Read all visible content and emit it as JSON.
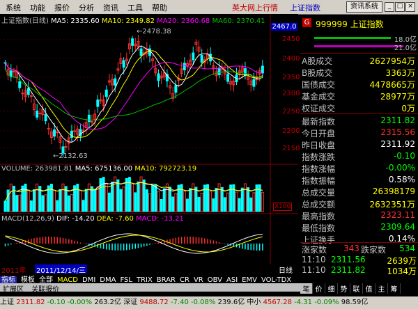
{
  "menu": [
    "系统",
    "功能",
    "报价",
    "分析",
    "资讯",
    "工具",
    "帮助"
  ],
  "menu_title": "英大网上行情",
  "menu_index": "上证指数",
  "menu_button": "资讯系统",
  "colors": {
    "up": "#ff3030",
    "down": "#00ffff",
    "ma5": "#ffffff",
    "ma10": "#ffff00",
    "ma20": "#ff00ff",
    "ma60": "#00c000",
    "label": "#c00000"
  },
  "chart_head": {
    "name": "上证指数(日线)",
    "ma5": "MA5: 2335.60",
    "ma10": "MA10: 2349.82",
    "ma20": "MA20: 2360.68",
    "ma60": "MA60: 2370.41"
  },
  "price_box": "2467.0",
  "high_label": "2478.38",
  "low_label": "2132.63",
  "price_axis": [
    "2450",
    "2400",
    "2350",
    "2300",
    "2250",
    "2200",
    "2150"
  ],
  "volume_head": {
    "vol": "VOLUME: 263981.81",
    "ma5": "MA5: 675136.00",
    "ma10": "MA10: 792723.19"
  },
  "vol_unit": "X100",
  "macd_head": {
    "label": "MACD(12,26,9)",
    "dif": "DIF: -14.20",
    "dea": "DEA: -7.60",
    "macd": "MACD: -13.21"
  },
  "bottom_axis": {
    "year": "2011年",
    "date": "2011/12/14/三",
    "day_label": "日线"
  },
  "tabs": [
    "指标",
    "模板",
    "全部",
    "MACD",
    "DMI",
    "DMA",
    "FSL",
    "TRIX",
    "BRAR",
    "CR",
    "VR",
    "OBV",
    "ASI",
    "EMV",
    "VOL-TDX"
  ],
  "ext_tabs": [
    "扩展区",
    "关联报价"
  ],
  "right_tabs": [
    "笔",
    "价",
    "细",
    "势",
    "联",
    "值",
    "主",
    "筹"
  ],
  "right": {
    "g_label": "G",
    "code": "999999 上证指数",
    "pct1": "18.0亿",
    "pct2": "21.0亿",
    "rows1": [
      {
        "label": "A股成交",
        "value": "2627954万",
        "color": "#ffff00"
      },
      {
        "label": "B股成交",
        "value": "3363万",
        "color": "#ffff00"
      },
      {
        "label": "国债成交",
        "value": "4478665万",
        "color": "#ffff00"
      },
      {
        "label": "基金成交",
        "value": "28977万",
        "color": "#ffff00"
      },
      {
        "label": "权证成交",
        "value": "0万",
        "color": "#ffff00"
      }
    ],
    "rows2": [
      {
        "label": "最新指数",
        "value": "2311.82",
        "color": "#00ff00"
      },
      {
        "label": "今日开盘",
        "value": "2315.56",
        "color": "#ff3030"
      },
      {
        "label": "昨日收盘",
        "value": "2311.92",
        "color": "#ffffff"
      },
      {
        "label": "指数涨跌",
        "value": "-0.10",
        "color": "#00ff00"
      },
      {
        "label": "指数涨幅",
        "value": "-0.00%",
        "color": "#00ff00"
      },
      {
        "label": "指数振幅",
        "value": "0.58%",
        "color": "#ffffff"
      },
      {
        "label": "总成交量",
        "value": "26398179",
        "color": "#ffff00"
      },
      {
        "label": "总成交额",
        "value": "2632351万",
        "color": "#ffff00"
      },
      {
        "label": "最高指数",
        "value": "2323.11",
        "color": "#ff3030"
      },
      {
        "label": "最低指数",
        "value": "2309.64",
        "color": "#00ff00"
      },
      {
        "label": "上证换手",
        "value": "0.14%",
        "color": "#ffffff"
      }
    ],
    "updown": {
      "up_label": "涨家数",
      "up": "343",
      "down_label": "跌家数",
      "down": "534"
    },
    "ticks": [
      {
        "time": "11:10",
        "price": "2311.56",
        "vol": "2639万"
      },
      {
        "time": "11:10",
        "price": "2311.82",
        "vol": "1034万"
      }
    ]
  },
  "status": {
    "sh_label": "上证",
    "sh": "2311.82",
    "sh_chg": "-0.10",
    "sh_pct": "-0.00%",
    "sh_amt": "263.2亿",
    "sz_label": "深证",
    "sz": "9488.72",
    "sz_chg": "-7.40",
    "sz_pct": "-0.08%",
    "sz_amt": "239.6亿",
    "zx_label": "中小",
    "zx": "4567.28",
    "zx_chg": "-4.31",
    "zx_pct": "-0.09%",
    "zx_amt": "98.59亿"
  }
}
